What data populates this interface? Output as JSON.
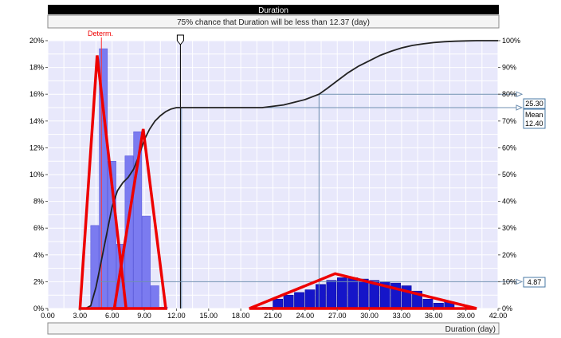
{
  "title_bar": {
    "text": "Duration"
  },
  "subtitle": {
    "text": "75% chance that Duration will be less than 12.37 (day)"
  },
  "determ_label": "Determ.",
  "x_axis_label": "Duration (day)",
  "marker_callouts": [
    {
      "pct": 80,
      "label": "25.30"
    },
    {
      "pct": 75,
      "label": "Mean"
    },
    {
      "pct": 75,
      "label2": "12.40"
    },
    {
      "pct": 10,
      "label": "4.87"
    }
  ],
  "colors": {
    "title_bar_bg": "#000000",
    "title_bar_fg": "#ffffff",
    "plot_bg": "#e8e8fb",
    "bar_dark": "#1515c9",
    "bar_light": "#7b7bf0",
    "cumulative_line": "#222222",
    "annotation_red": "#ee0000",
    "marker_line": "#6f8fb0",
    "determ_line": "#ff3333"
  },
  "chart_data": {
    "type": "bar",
    "title": "Duration",
    "subtitle": "75% chance that Duration will be less than 12.37 (day)",
    "xlabel": "Duration (day)",
    "xlim": [
      0,
      42
    ],
    "ylim_left": [
      0,
      20
    ],
    "ylim_right": [
      0,
      100
    ],
    "x_ticks": [
      "0.00",
      "3.00",
      "6.00",
      "9.00",
      "12.00",
      "15.00",
      "18.00",
      "21.00",
      "24.00",
      "27.00",
      "30.00",
      "33.00",
      "36.00",
      "39.00",
      "42.00"
    ],
    "y_left_ticks": [
      "0%",
      "2%",
      "4%",
      "6%",
      "8%",
      "10%",
      "12%",
      "14%",
      "16%",
      "18%",
      "20%"
    ],
    "y_right_ticks": [
      "0%",
      "10%",
      "20%",
      "30%",
      "40%",
      "50%",
      "60%",
      "70%",
      "80%",
      "90%",
      "100%"
    ],
    "histogram": {
      "x_start": [
        4.0,
        4.8,
        5.6,
        6.4,
        7.2,
        8.0,
        8.8,
        9.6,
        10.4,
        20.0,
        21.0,
        22.0,
        23.0,
        24.0,
        25.0,
        26.0,
        27.0,
        28.0,
        29.0,
        30.0,
        31.0,
        32.0,
        33.0,
        34.0,
        35.0,
        36.0,
        37.0
      ],
      "bin_width": 0.8,
      "wide_bin_width": 0.95,
      "values_pct": [
        6.2,
        19.4,
        11.0,
        4.8,
        11.4,
        13.2,
        6.9,
        1.7,
        0.1,
        0.1,
        0.7,
        1.0,
        1.2,
        1.4,
        1.8,
        2.1,
        2.3,
        2.3,
        2.2,
        2.1,
        2.0,
        1.9,
        1.7,
        1.3,
        0.7,
        0.4,
        0.5
      ],
      "shade": [
        "light",
        "light",
        "light",
        "light",
        "light",
        "light",
        "light",
        "light",
        "light",
        "dark",
        "dark",
        "dark",
        "dark",
        "dark",
        "dark",
        "dark",
        "dark",
        "dark",
        "dark",
        "dark",
        "dark",
        "dark",
        "dark",
        "dark",
        "dark",
        "dark",
        "dark"
      ]
    },
    "cumulative": {
      "x": [
        3.5,
        4.0,
        4.5,
        5.0,
        5.5,
        6.0,
        6.5,
        7.0,
        7.5,
        8.0,
        8.5,
        9.0,
        9.5,
        10.0,
        10.5,
        11.0,
        11.5,
        12.0,
        13.0,
        15.0,
        18.0,
        20.0,
        22.0,
        24.0,
        25.3,
        26.0,
        27.0,
        28.0,
        29.0,
        30.0,
        31.0,
        32.0,
        33.0,
        34.0,
        35.0,
        36.0,
        37.0,
        38.0,
        39.0,
        40.0,
        42.0
      ],
      "pct": [
        0,
        1,
        8,
        18,
        28,
        38,
        44,
        47,
        49,
        52,
        57,
        63,
        67,
        70,
        72,
        73.5,
        74.5,
        75,
        75,
        75,
        75,
        75,
        76,
        78,
        80,
        82,
        85,
        88,
        90.5,
        92.5,
        94.5,
        96,
        97.3,
        98.2,
        98.8,
        99.3,
        99.6,
        99.8,
        99.9,
        100,
        100
      ]
    },
    "annotations": {
      "red_triangles": [
        {
          "x": [
            3.0,
            4.6,
            7.3
          ],
          "y_pct": [
            0,
            18.9,
            0
          ]
        },
        {
          "x": [
            6.2,
            8.9,
            11.0
          ],
          "y_pct": [
            0,
            13.4,
            0
          ]
        },
        {
          "x": [
            18.8,
            26.8,
            40.0
          ],
          "y_pct": [
            0,
            2.6,
            0
          ]
        }
      ],
      "determ_x": 5.0,
      "slider_x": 12.37,
      "mean_x": 12.4,
      "p80_x": 25.3,
      "p10_x": 4.87
    }
  }
}
